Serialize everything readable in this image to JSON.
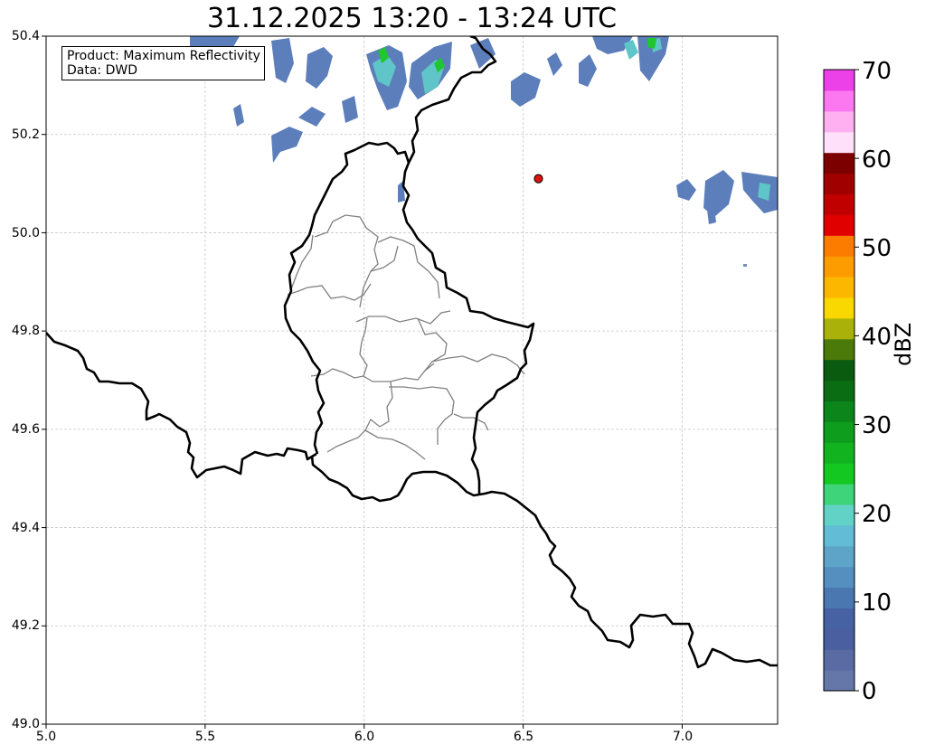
{
  "title": "31.12.2025 13:20 - 13:24 UTC",
  "info_box": {
    "product": "Product: Maximum Reflectivity",
    "data": "Data: DWD"
  },
  "axes": {
    "lon_ticks": [
      "5.0",
      "5.5",
      "6.0",
      "6.5",
      "7.0"
    ],
    "lat_ticks": [
      "50.4",
      "50.2",
      "50.0",
      "49.8",
      "49.6",
      "49.4",
      "49.2",
      "49.0"
    ],
    "lon_range": [
      5.0,
      7.3
    ],
    "lat_range": [
      49.0,
      50.4
    ],
    "grid": true
  },
  "colorbar": {
    "label": "dBZ",
    "ticks": [
      "70",
      "60",
      "50",
      "40",
      "30",
      "20",
      "10",
      "0"
    ],
    "range": [
      0,
      70
    ],
    "step": 2.5,
    "colors_bottom_to_top": [
      "#6577a8",
      "#5a6ba4",
      "#4a5fa0",
      "#4762a3",
      "#4a77b0",
      "#548fc0",
      "#5ea4c9",
      "#62bcd5",
      "#63d2c6",
      "#3dd47a",
      "#14c822",
      "#11b41f",
      "#0e9d1c",
      "#0c851a",
      "#0a6d14",
      "#0a5a10",
      "#4b7a0a",
      "#aab20a",
      "#f8d800",
      "#fcb800",
      "#fc9c00",
      "#fc7c00",
      "#e00000",
      "#c00000",
      "#a00000",
      "#7c0000",
      "#ffe0fa",
      "#ffb0f0",
      "#fc78f0",
      "#ec40e8"
    ]
  },
  "station_marker": {
    "name": "station",
    "lon": 6.548,
    "lat": 50.11,
    "color": "#dd1111"
  },
  "colors": {
    "border": "#000000",
    "admin": "#808080",
    "grid": "#c8c8c8"
  }
}
